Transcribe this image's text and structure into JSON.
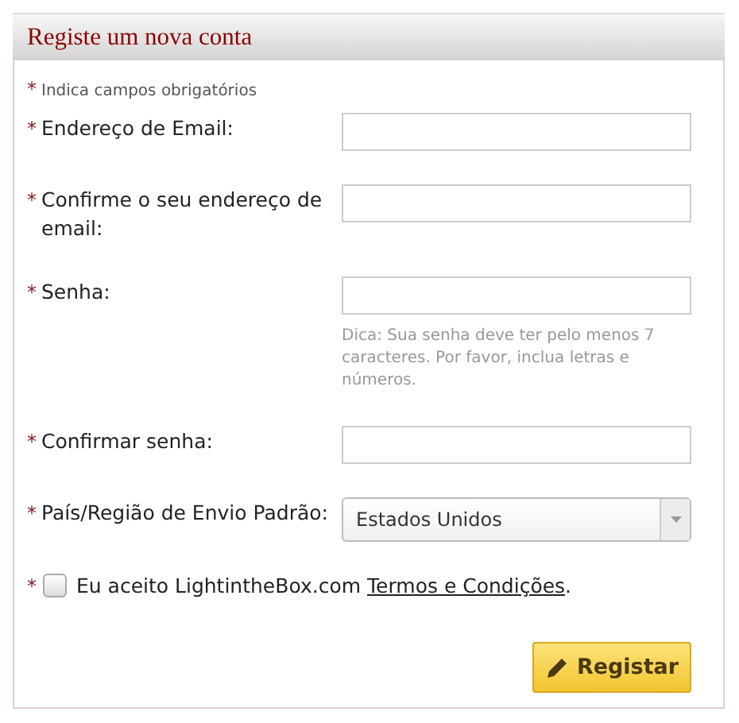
{
  "panel": {
    "title": "Registe um nova conta"
  },
  "required_note": {
    "mark": "*",
    "text": "Indica campos obrigatórios"
  },
  "fields": [
    {
      "kind": "text",
      "mark": "*",
      "label": "Endereço de Email:"
    },
    {
      "kind": "text",
      "mark": "*",
      "label": "Confirme o seu endereço de email:"
    },
    {
      "kind": "text",
      "mark": "*",
      "label": "Senha:",
      "hint": "Dica: Sua senha deve ter pelo menos 7 caracteres. Por favor, inclua letras e números."
    },
    {
      "kind": "text",
      "mark": "*",
      "label": "Confirmar senha:"
    },
    {
      "kind": "select",
      "mark": "*",
      "label": "País/Região de Envio Padrão:",
      "value": "Estados Unidos"
    }
  ],
  "agreement": {
    "mark": "*",
    "checked": false,
    "text": "Eu aceito LightintheBox.com",
    "link": "Termos e Condições",
    "suffix": "."
  },
  "submit_button": {
    "label": "Registar"
  }
}
